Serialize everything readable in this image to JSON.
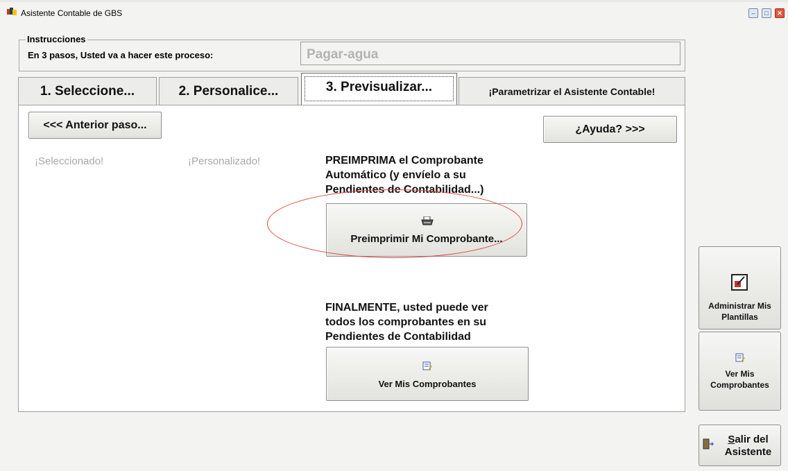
{
  "window": {
    "title": "Asistente Contable de GBS",
    "controls": [
      "minimize",
      "maximize",
      "close"
    ]
  },
  "instructions": {
    "legend": "Instrucciones",
    "text": "En 3 pasos,  Usted va a  hacer este proceso:",
    "process_value": "Pagar-agua"
  },
  "tabs": [
    {
      "label": "1. Seleccione...",
      "active": false
    },
    {
      "label": "2. Personalice...",
      "active": false
    },
    {
      "label": "3. Previsualizar...",
      "active": true
    },
    {
      "label": "¡Parametrizar el Asistente Contable!",
      "active": false
    }
  ],
  "panel": {
    "prev_button": "<<< Anterior paso...",
    "help_button": "¿Ayuda? >>>",
    "status_selected": "¡Seleccionado!",
    "status_personalized": "¡Personalizado!",
    "preprint_text": [
      "PREIMPRIMA el Comprobante",
      "Automático (y envíelo a su",
      "Pendientes de Contabilidad...)"
    ],
    "preprint_button": "Preimprimir Mi Comprobante...",
    "final_text": [
      "FINALMENTE, usted puede ver",
      "todos los comprobantes en su",
      "Pendientes de Contabilidad"
    ],
    "view_button": "Ver Mis Comprobantes"
  },
  "side": {
    "admin_button": [
      "Administrar Mis",
      "Plantillas"
    ],
    "view_button": [
      "Ver Mis",
      "Comprobantes"
    ],
    "exit_button": {
      "accel": "S",
      "line1_rest": "alir del",
      "line2": "Asistente"
    }
  },
  "icons": {
    "app": "gbs-app-icon",
    "printer": "printer-icon",
    "document": "document-edit-icon",
    "admin": "template-admin-icon",
    "exit": "exit-door-icon"
  },
  "colors": {
    "highlight_ellipse": "#e0403a",
    "disabled_text": "#a8a8a8"
  }
}
